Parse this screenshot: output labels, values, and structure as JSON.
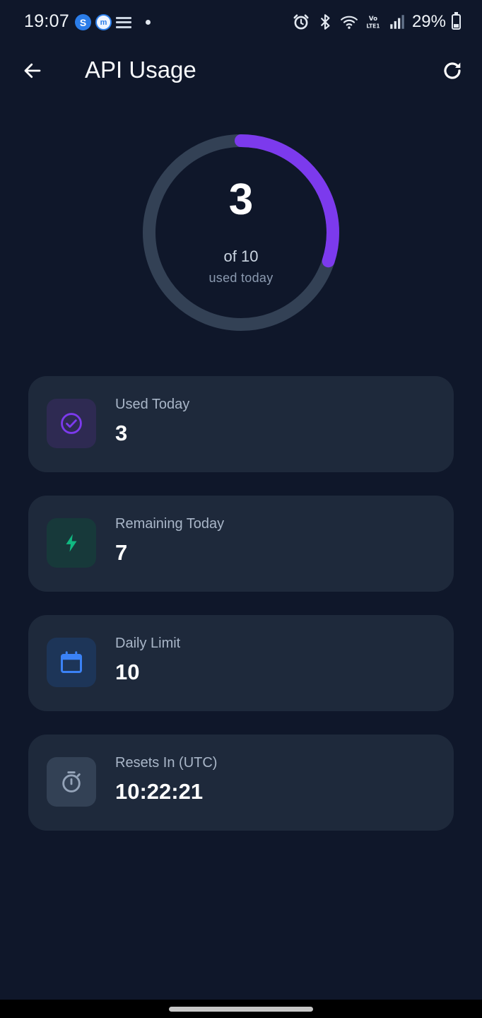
{
  "status_bar": {
    "time": "19:07",
    "battery_percent": "29%",
    "battery_level": 0.29,
    "icons": [
      "s-app-icon",
      "m-app-icon",
      "notification-icon",
      "dot-icon",
      "alarm-icon",
      "bluetooth-icon",
      "wifi-icon",
      "volte-icon",
      "signal-icon",
      "battery-icon"
    ]
  },
  "header": {
    "title": "API Usage",
    "back_icon": "arrow-left-icon",
    "refresh_icon": "refresh-icon"
  },
  "usage_ring": {
    "value": "3",
    "of_text": "of 10",
    "subtitle": "used today",
    "used": 3,
    "limit": 10,
    "track_color": "#334155",
    "progress_color": "#7c3aed"
  },
  "stats": {
    "used": {
      "label": "Used Today",
      "value": "3",
      "icon": "check-circle-icon",
      "color": "#7c3aed"
    },
    "remaining": {
      "label": "Remaining Today",
      "value": "7",
      "icon": "lightning-icon",
      "color": "#10b981"
    },
    "limit": {
      "label": "Daily Limit",
      "value": "10",
      "icon": "calendar-icon",
      "color": "#3b82f6"
    },
    "reset": {
      "label": "Resets In (UTC)",
      "value": "10:22:21",
      "icon": "timer-icon",
      "color": "#94a3b8"
    }
  },
  "colors": {
    "background": "#0f172a",
    "card": "#1e293b",
    "accent": "#7c3aed"
  }
}
